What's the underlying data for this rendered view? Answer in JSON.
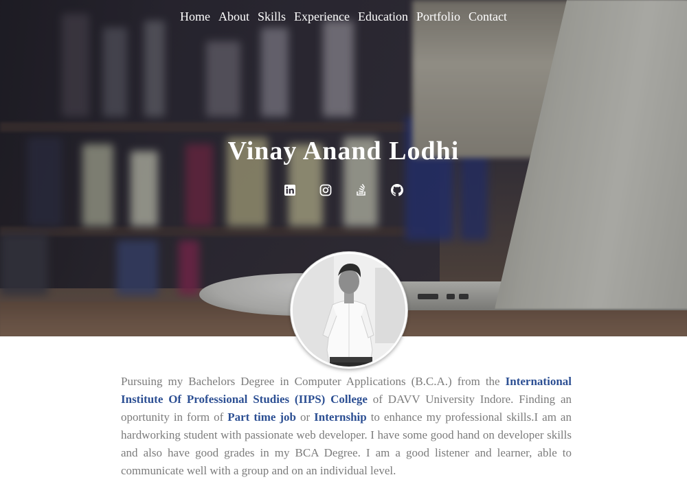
{
  "nav": {
    "items": [
      "Home",
      "About",
      "Skills",
      "Experience",
      "Education",
      "Portfolio",
      "Contact"
    ]
  },
  "hero": {
    "name": "Vinay Anand Lodhi",
    "socials": [
      "linkedin-icon",
      "instagram-icon",
      "stackoverflow-icon",
      "github-icon"
    ]
  },
  "about": {
    "t1": "Pursuing my Bachelors Degree in Computer Applications (B.C.A.) from the ",
    "college": "International Institute Of Professional Studies (IIPS) College",
    "t2": " of DAVV University Indore. Finding an oportunity in form of ",
    "job": "Part time job",
    "t3": " or ",
    "internship": "Internship",
    "t4": " to enhance my professional skills.I am an hardworking student with passionate web developer. I have some good hand on developer skills and also have good grades in my BCA Degree. I am a good listener and learner, able to communicate well with a group and on an individual level."
  },
  "colors": {
    "highlight": "#2c4f93",
    "body_text": "#7b7b7b",
    "nav_text": "#ffffff"
  }
}
